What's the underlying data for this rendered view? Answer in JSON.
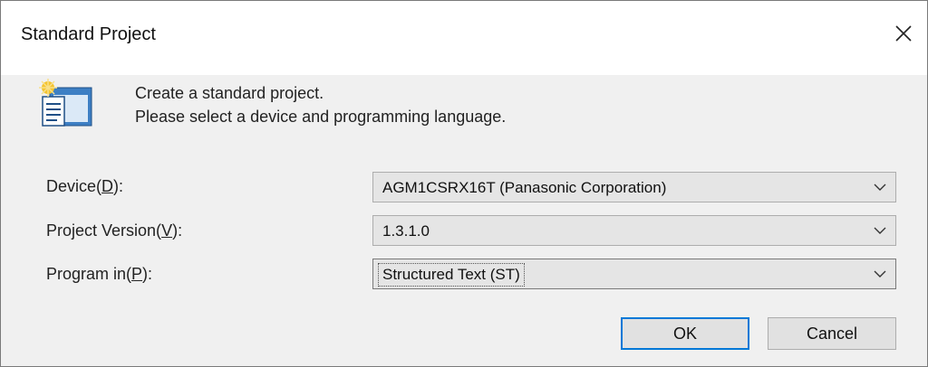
{
  "window": {
    "title": "Standard Project"
  },
  "header": {
    "line1": "Create a standard project.",
    "line2": "Please select a device and programming language."
  },
  "fields": {
    "device": {
      "label_pre": "Device(",
      "label_key": "D",
      "label_post": "):",
      "value": "AGM1CSRX16T (Panasonic Corporation)"
    },
    "version": {
      "label_pre": "Project Version(",
      "label_key": "V",
      "label_post": "):",
      "value": "1.3.1.0"
    },
    "program": {
      "label_pre": "Program in(",
      "label_key": "P",
      "label_post": "):",
      "value": "Structured Text (ST)"
    }
  },
  "buttons": {
    "ok": "OK",
    "cancel": "Cancel"
  },
  "icons": {
    "close": "close-icon",
    "header": "project-icon",
    "dropdown": "chevron-down-icon"
  }
}
